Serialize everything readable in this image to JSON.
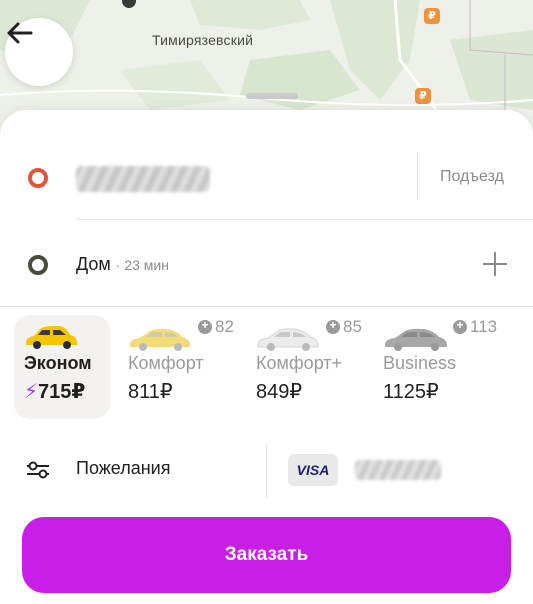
{
  "map": {
    "district_label": "Тимирязевский",
    "price_pins": [
      "₽",
      "₽"
    ]
  },
  "header": {
    "back_icon": "arrow-left-icon"
  },
  "route": {
    "pickup_address": "",
    "entrance_label": "Подъезд",
    "destination_name": "Дом",
    "destination_time": "· 23 мин",
    "add_stop_icon": "plus-icon",
    "pickup_pin_color": "#e1553b",
    "destination_pin_color": "#4a4a3f"
  },
  "tariffs": [
    {
      "name": "Эконом",
      "price": "715₽",
      "badge": "",
      "selected": true,
      "car_color": "#f5c500",
      "icon": "lightning-icon"
    },
    {
      "name": "Комфорт",
      "price": "811₽",
      "badge": "82",
      "selected": false,
      "car_color": "#f3dc77"
    },
    {
      "name": "Комфорт+",
      "price": "849₽",
      "badge": "85",
      "selected": false,
      "car_color": "#e8e8e8"
    },
    {
      "name": "Business",
      "price": "1125₽",
      "badge": "113",
      "selected": false,
      "car_color": "#a8a8a8"
    }
  ],
  "options": {
    "preferences_label": "Пожелания",
    "payment_brand": "VISA",
    "card_number": ""
  },
  "order_button": {
    "label": "Заказать",
    "color": "#c81ee6"
  }
}
